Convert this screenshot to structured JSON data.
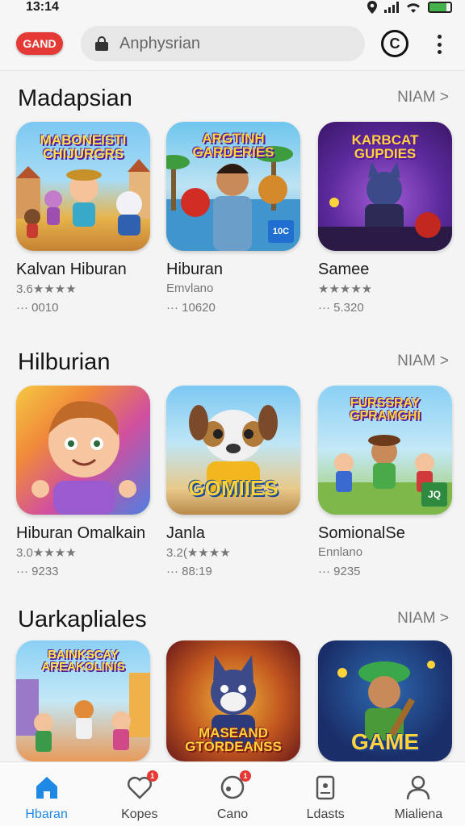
{
  "status": {
    "time": "13:14"
  },
  "browser": {
    "logo": "GAND",
    "url": "Anphysrian",
    "circle_icon_letter": "C"
  },
  "sections": [
    {
      "title": "Madapsian",
      "more": "NIAM >",
      "tiles": [
        {
          "art_text": "MABONEISTI CHIJURGRS",
          "name": "Kalvan Hiburan",
          "sub": "3.6★★★★",
          "downloads": "··· 0010"
        },
        {
          "art_text": "ARGTINH GARDERIES",
          "art_badge": "10C",
          "name": "Hiburan",
          "sub": "Emvlano",
          "downloads": "··· 10620"
        },
        {
          "art_text": "KARBCAT GUPDIES",
          "name": "Samee",
          "sub": "★★★★★",
          "downloads": "··· 5.320"
        }
      ]
    },
    {
      "title": "Hilburian",
      "more": "NIAM >",
      "tiles": [
        {
          "art_text": "",
          "name": "Hiburan Omalkain",
          "sub": "3.0★★★★",
          "downloads": "··· 9233"
        },
        {
          "art_text": "GOMIIES",
          "name": "Janla",
          "sub": "3.2(★★★★",
          "downloads": "··· 88:19"
        },
        {
          "art_text": "FURSSRAY GPRAMGHI",
          "art_badge": "JQ",
          "name": "SomionalSe",
          "sub": "Ennlano",
          "downloads": "··· 9235"
        }
      ]
    },
    {
      "title": "Uarkapliales",
      "more": "NIAM >",
      "tiles": [
        {
          "art_text": "BAINKSCAY AREAKOLINIS",
          "name": "",
          "sub": "",
          "downloads": ""
        },
        {
          "art_text": "MASEAND GTORDEANSS",
          "name": "",
          "sub": "",
          "downloads": ""
        },
        {
          "art_text": "GAME",
          "name": "",
          "sub": "",
          "downloads": ""
        }
      ]
    }
  ],
  "nav": [
    {
      "label": "Hbaran",
      "icon": "home-icon",
      "active": true
    },
    {
      "label": "Kopes",
      "icon": "heart-icon",
      "badge": "1"
    },
    {
      "label": "Cano",
      "icon": "disc-icon",
      "badge": "1"
    },
    {
      "label": "Ldasts",
      "icon": "device-icon"
    },
    {
      "label": "Mialiena",
      "icon": "profile-icon"
    }
  ],
  "colors": {
    "accent": "#1e88e5",
    "badge": "#e53935",
    "logo": "#e53935"
  }
}
